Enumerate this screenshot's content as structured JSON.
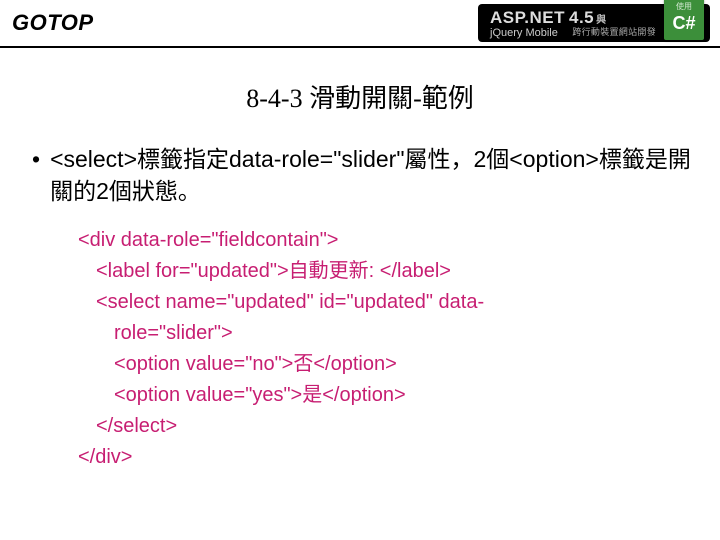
{
  "header": {
    "logo": "GOTOP",
    "badge": {
      "asp_prefix": "ASP.NET",
      "asp_version": "4.5",
      "amp": "與",
      "jquery": "jQuery Mobile",
      "subtitle": "跨行動裝置網站開發",
      "use_label": "使用",
      "cs": "C#"
    }
  },
  "title": "8-4-3 滑動開關-範例",
  "bullet": {
    "mark": "•",
    "text": "<select>標籤指定data-role=\"slider\"屬性，2個<option>標籤是開關的2個狀態。"
  },
  "code": {
    "l0": "<div data-role=\"fieldcontain\">",
    "l1": "<label for=\"updated\">自動更新: </label>",
    "l2": "<select name=\"updated\" id=\"updated\" data-",
    "l3": "role=\"slider\">",
    "l4": "<option value=\"no\">否</option>",
    "l5": "<option value=\"yes\">是</option>",
    "l6": "</select>",
    "l7": "</div>"
  }
}
